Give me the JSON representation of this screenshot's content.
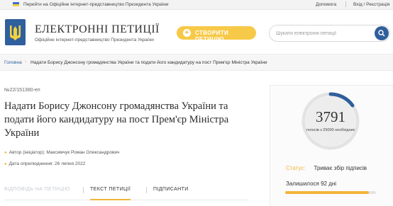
{
  "topbar": {
    "official_link": "Перейти на Офіційне інтернет-представництво Президента України",
    "help": "Допомога",
    "auth": "Вхід / Реєстрація"
  },
  "header": {
    "title": "ЕЛЕКТРОННІ ПЕТИЦІЇ",
    "subtitle": "Офіційне інтернет-представництво Президента України",
    "create_button": "СТВОРИТИ ПЕТИЦІЮ",
    "search_placeholder": "Шукати електронні петиції"
  },
  "colors": {
    "accent": "#f2b53a",
    "brand_blue": "#2f5f9c"
  },
  "breadcrumb": {
    "home": "Головна",
    "current": "Надати Борису Джонсону громадянства України та подати його кандидатуру на пост Прем'єр Міністра України"
  },
  "petition": {
    "number": "№22/151380-еп",
    "title": "Надати Борису Джонсону громадянства України та подати його кандидатуру на пост Прем'єр Міністра України",
    "author_label": "Автор (ініціатор): Максимчук Роман Олександрович",
    "date_label": "Дата оприлюднення: 26 липня 2022"
  },
  "tabs": [
    {
      "label": "ВІДПОВІДЬ НА ПЕТИЦІЮ"
    },
    {
      "label": "ТЕКСТ ПЕТИЦІЇ"
    },
    {
      "label": "ПІДПИСАНТИ"
    }
  ],
  "stats": {
    "votes": "3791",
    "votes_caption": "голосів з 25000 необхідних",
    "progress_fraction": 0.15164,
    "status_label": "Статус:",
    "status_value": "Триває збір підписів",
    "remaining": "Залишилося 92 дні",
    "remaining_fraction": 0.92
  }
}
